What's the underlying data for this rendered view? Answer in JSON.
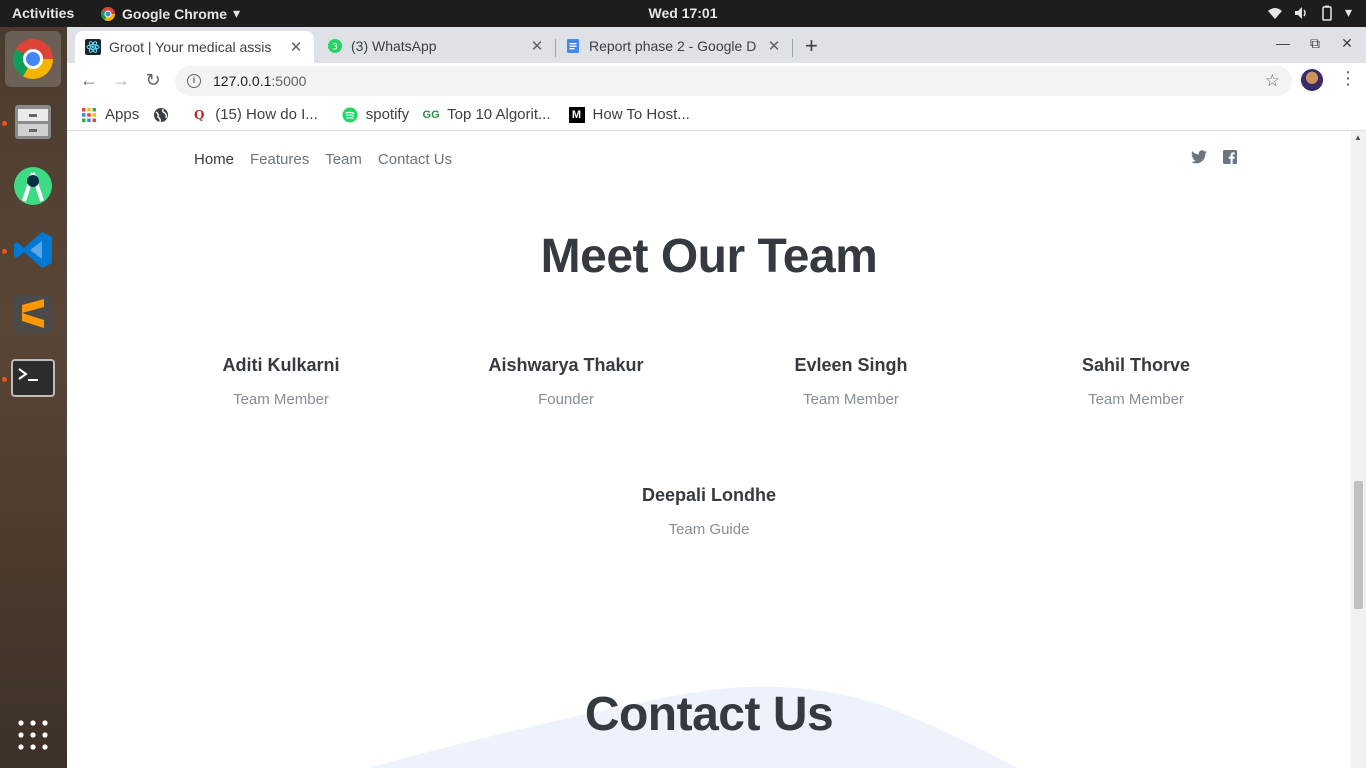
{
  "system": {
    "activities": "Activities",
    "app_name": "Google Chrome",
    "clock": "Wed 17:01"
  },
  "tabs": [
    {
      "title": "Groot | Your medical assis",
      "active": true
    },
    {
      "title": "(3) WhatsApp",
      "badge": "3"
    },
    {
      "title": "Report phase 2 - Google D"
    }
  ],
  "address_bar": {
    "url_host": "127.0.0.1",
    "url_port": ":5000"
  },
  "bookmarks": [
    {
      "label": "Apps",
      "icon": "apps-grid-icon"
    },
    {
      "label": "",
      "icon": "globe-icon"
    },
    {
      "label": "(15) How do I...",
      "icon": "quora-icon"
    },
    {
      "label": "spotify",
      "icon": "spotify-icon"
    },
    {
      "label": "Top 10 Algorit...",
      "icon": "geeksforgeeks-icon"
    },
    {
      "label": "How To Host...",
      "icon": "medium-icon"
    }
  ],
  "site_nav": {
    "items": [
      "Home",
      "Features",
      "Team",
      "Contact Us"
    ],
    "active": "Home"
  },
  "team_section": {
    "heading": "Meet Our Team",
    "members": [
      {
        "name": "Aditi Kulkarni",
        "role": "Team Member"
      },
      {
        "name": "Aishwarya Thakur",
        "role": "Founder"
      },
      {
        "name": "Evleen Singh",
        "role": "Team Member"
      },
      {
        "name": "Sahil Thorve",
        "role": "Team Member"
      },
      {
        "name": "Deepali Londhe",
        "role": "Team Guide"
      }
    ]
  },
  "contact_section": {
    "heading": "Contact Us"
  },
  "colors": {
    "heading": "#343a40",
    "muted": "#868e96",
    "accent_wave": "#eef2fa"
  }
}
